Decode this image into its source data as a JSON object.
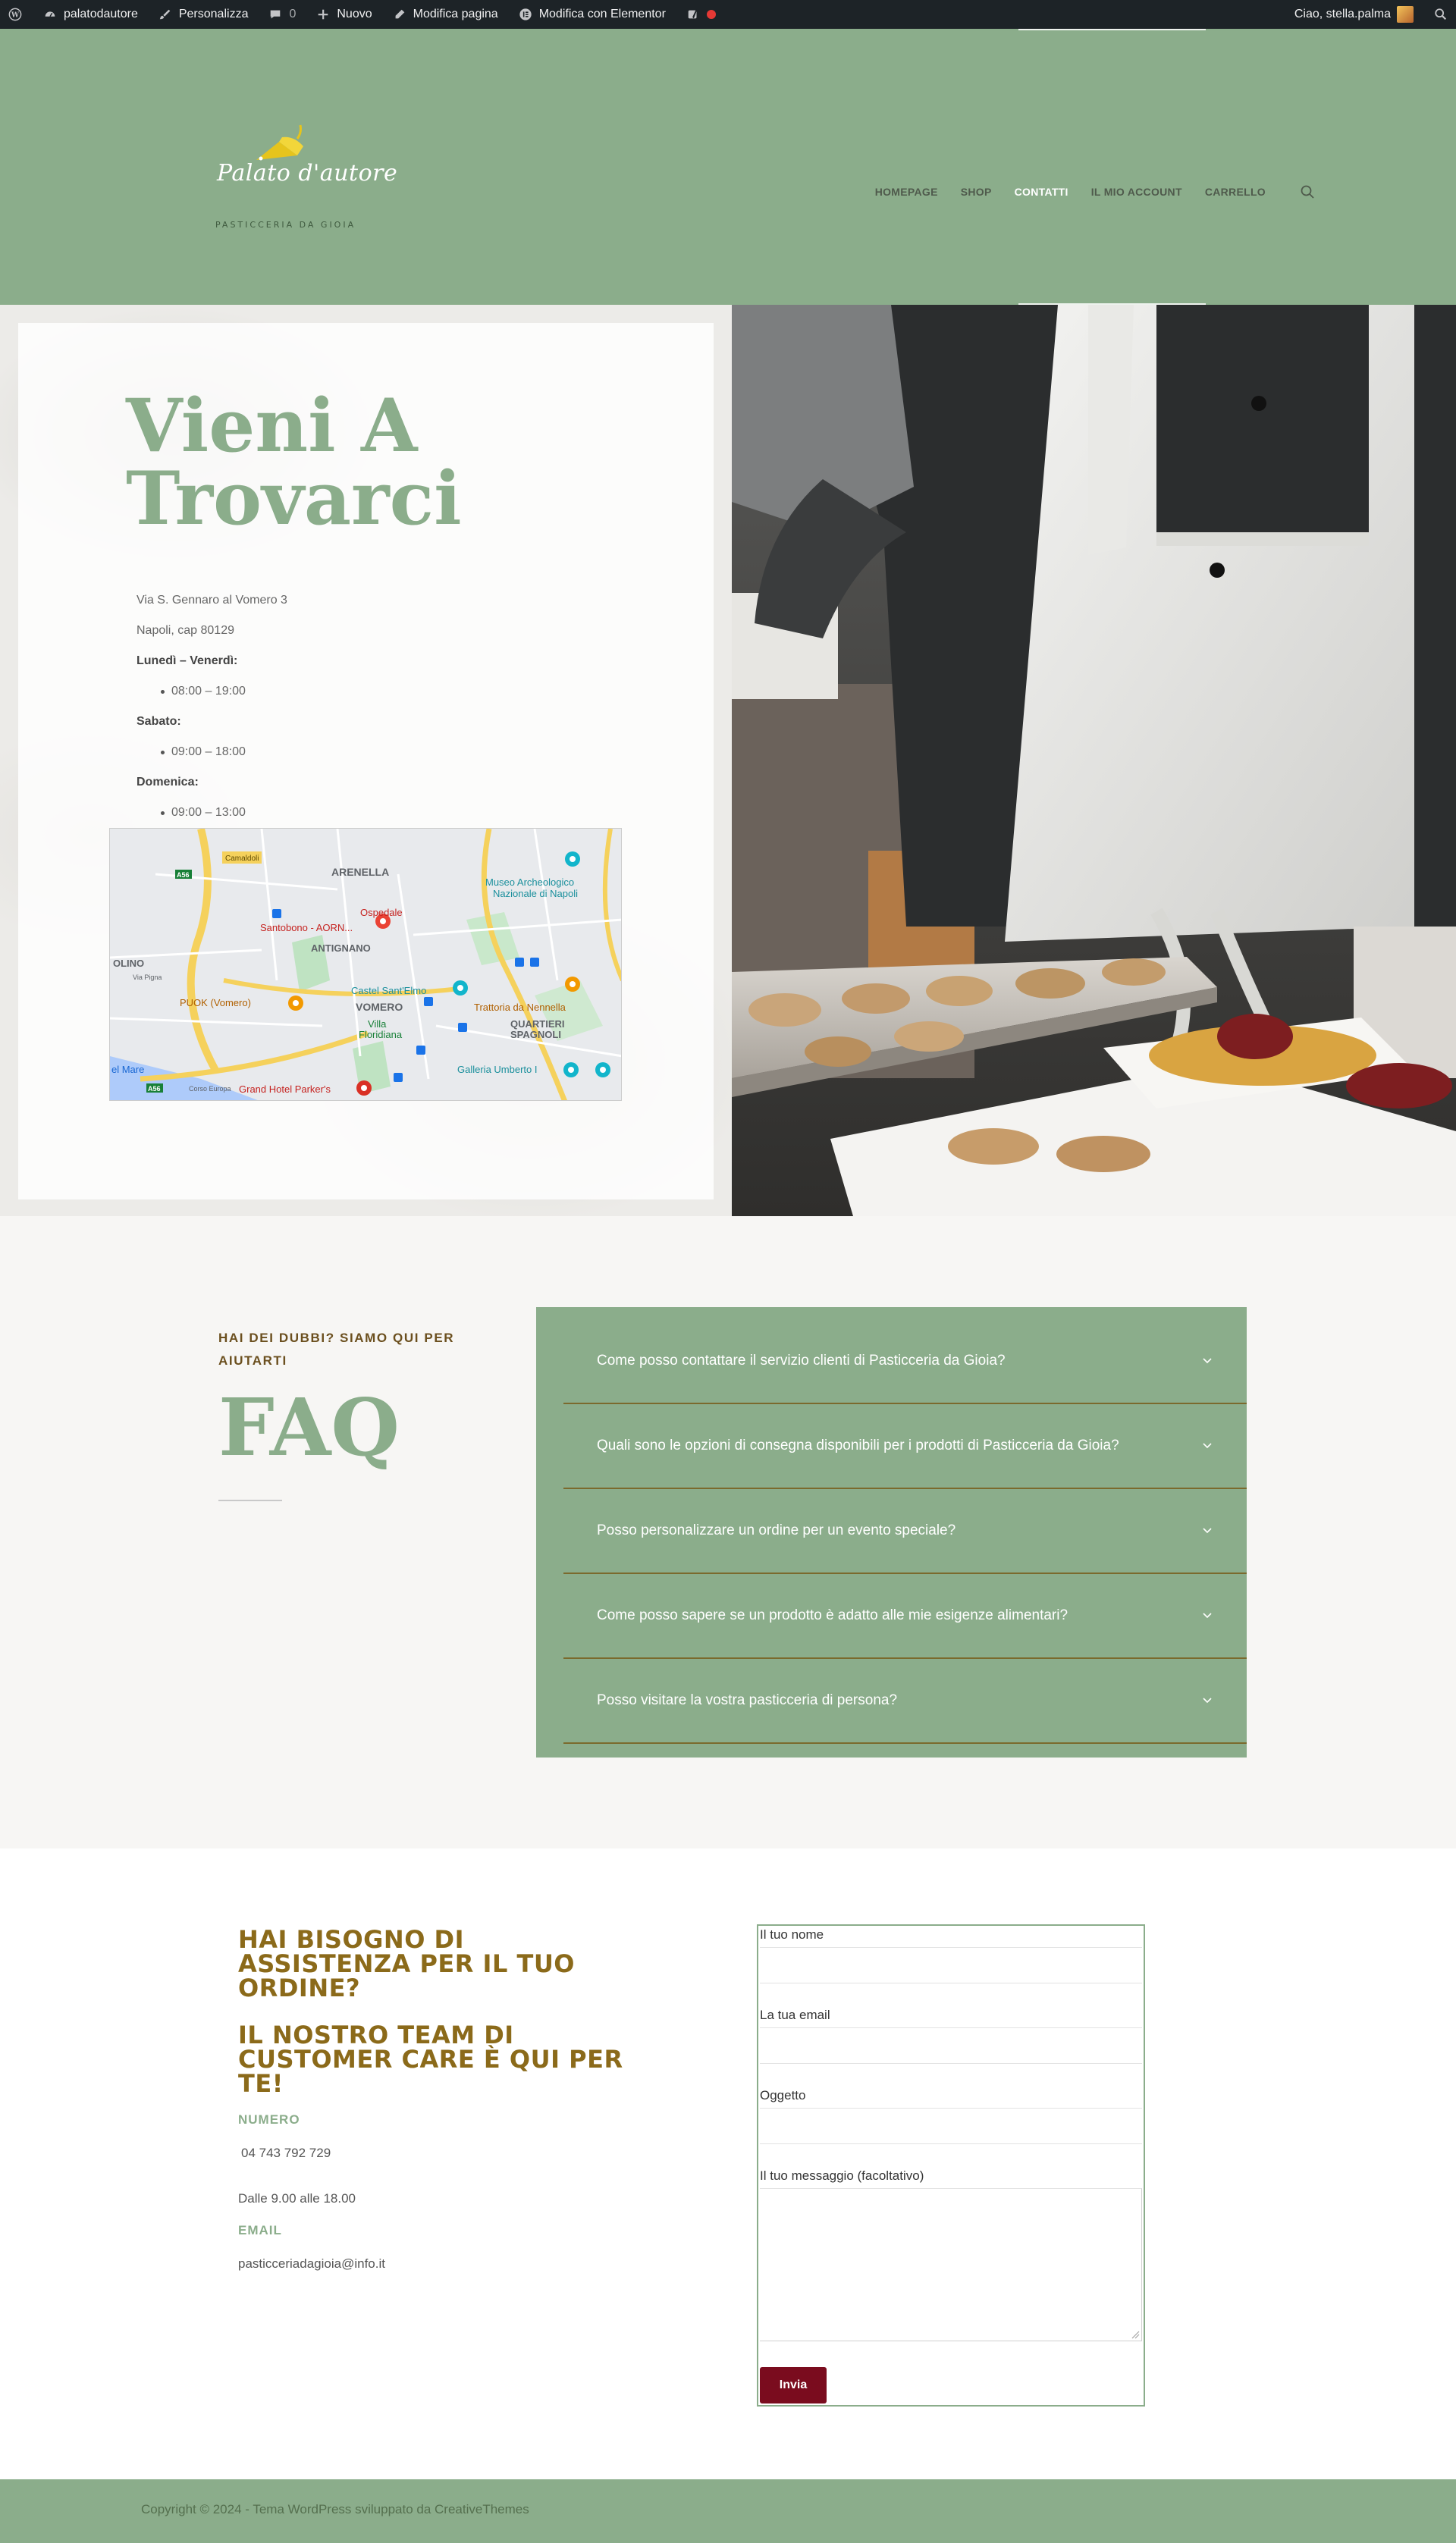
{
  "admin_bar": {
    "site_name": "palatodautore",
    "customize": "Personalizza",
    "comments_count": "0",
    "new_label": "Nuovo",
    "edit_page": "Modifica pagina",
    "edit_elementor": "Modifica con Elementor",
    "greeting": "Ciao, stella.palma"
  },
  "header": {
    "logo_script": "Palato d'autore",
    "logo_tagline": "PASTICCERIA DA GIOIA",
    "nav": [
      {
        "label": "HOMEPAGE"
      },
      {
        "label": "SHOP"
      },
      {
        "label": "CONTATTI"
      },
      {
        "label": "IL MIO ACCOUNT"
      },
      {
        "label": "CARRELLO"
      }
    ],
    "active_nav": "CONTATTI"
  },
  "hero": {
    "title": "Vieni A Trovarci",
    "address_line1": "Via S. Gennaro al Vomero 3",
    "address_line2": "Napoli, cap 80129",
    "hours": [
      {
        "day": "Lunedì – Venerdì:",
        "time": "08:00 – 19:00"
      },
      {
        "day": "Sabato:",
        "time": "09:00 – 18:00"
      },
      {
        "day": "Domenica:",
        "time": "09:00 – 13:00"
      }
    ],
    "map_labels": {
      "arenella": "ARENELLA",
      "museo": "Museo Archeologico Nazionale di Napoli",
      "ospedale": "Ospedale",
      "santobono": "Santobono - AORN...",
      "antignano": "ANTIGNANO",
      "olino": "OLINO",
      "castel": "Castel Sant'Elmo",
      "puok": "PUOK (Vomero)",
      "vomero": "VOMERO",
      "trattoria": "Trattoria da Nennella",
      "villa": "Villa Floridiana",
      "quartieri": "QUARTIERI SPAGNOLI",
      "galleria": "Galleria Umberto I",
      "mare": "el Mare",
      "hotel": "Grand Hotel Parker's",
      "camaldoli": "Camaldoli",
      "a56": "A56",
      "via_pigna": "Via Pigna",
      "corso": "Corso Europa"
    }
  },
  "faq": {
    "eyebrow": "HAI DEI DUBBI? SIAMO QUI PER AIUTARTI",
    "title": "FAQ",
    "items": [
      {
        "question": "Come posso contattare il servizio clienti di Pasticceria da Gioia?"
      },
      {
        "question": "Quali sono le opzioni di consegna disponibili per i prodotti di Pasticceria da Gioia?"
      },
      {
        "question": "Posso personalizzare un ordine per un evento speciale?"
      },
      {
        "question": "Come posso sapere se un prodotto è adatto alle mie esigenze alimentari?"
      },
      {
        "question": "Posso visitare la vostra pasticceria di persona?"
      }
    ]
  },
  "support": {
    "heading_1": "HAI BISOGNO DI ASSISTENZA PER IL TUO ORDINE?",
    "heading_2": "IL NOSTRO TEAM DI CUSTOMER CARE È QUI PER TE!",
    "number_label": "NUMERO",
    "number_value": "04 743 792 729",
    "hours_value": "Dalle 9.00 alle 18.00",
    "email_label": "EMAIL",
    "email_value": "pasticceriadagioia@info.it"
  },
  "form": {
    "name_label": "Il tuo nome",
    "email_label": "La tua email",
    "subject_label": "Oggetto",
    "message_label": "Il tuo messaggio (facoltativo)",
    "submit_label": "Invia"
  },
  "footer": {
    "copyright": "Copyright © 2024 - Tema WordPress sviluppato da CreativeThemes"
  },
  "colors": {
    "sage": "#8bad8b",
    "gold": "#8b6a1a",
    "burgundy": "#7a0c1e",
    "admin_bar": "#1d2327"
  }
}
